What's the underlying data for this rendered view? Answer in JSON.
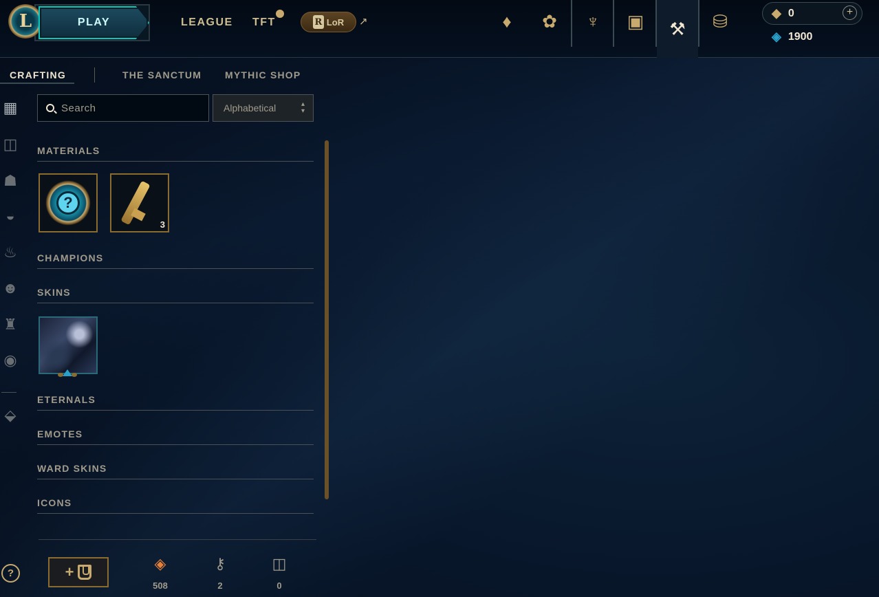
{
  "header": {
    "logo_letter": "L",
    "play_label": "PLAY",
    "nav": [
      {
        "label": "LEAGUE"
      },
      {
        "label": "TFT"
      }
    ],
    "lor_label": "LoR",
    "lor_letter": "R",
    "external_arrow": "↗",
    "icons": [
      {
        "name": "crystal-icon",
        "glyph": "♦"
      },
      {
        "name": "lotus-icon",
        "glyph": "✿"
      },
      {
        "name": "trophy-icon",
        "glyph": "♆"
      },
      {
        "name": "collection-bag-icon",
        "glyph": "▣"
      },
      {
        "name": "loot-hammer-icon",
        "glyph": "⚒"
      },
      {
        "name": "store-coins-icon",
        "glyph": "⛁"
      }
    ],
    "currencies": {
      "riot_points": "0",
      "blue_essence": "1900",
      "add_label": "+"
    }
  },
  "subtabs": [
    {
      "label": "CRAFTING",
      "active": true
    },
    {
      "label": "THE SANCTUM",
      "active": false
    },
    {
      "label": "MYTHIC SHOP",
      "active": false
    }
  ],
  "rail": [
    {
      "name": "rail-all-icon",
      "glyph": "▦"
    },
    {
      "name": "rail-chest-icon",
      "glyph": "◫"
    },
    {
      "name": "rail-champion-icon",
      "glyph": "☗"
    },
    {
      "name": "rail-skin-mask-icon",
      "glyph": "◒"
    },
    {
      "name": "rail-eternal-flame-icon",
      "glyph": "♨"
    },
    {
      "name": "rail-emote-icon",
      "glyph": "☻"
    },
    {
      "name": "rail-ward-icon",
      "glyph": "♜"
    },
    {
      "name": "rail-profile-icon",
      "glyph": "◉"
    },
    {
      "name": "rail-special-icon",
      "glyph": "⬙"
    }
  ],
  "help_label": "?",
  "search": {
    "placeholder": "Search"
  },
  "sort": {
    "selected": "Alphabetical",
    "arrows": "▲▼"
  },
  "sections": [
    {
      "label": "MATERIALS"
    },
    {
      "label": "CHAMPIONS"
    },
    {
      "label": "SKINS"
    },
    {
      "label": "ETERNALS"
    },
    {
      "label": "EMOTES"
    },
    {
      "label": "WARD SKINS"
    },
    {
      "label": "ICONS"
    }
  ],
  "materials": {
    "mystery_orb_symbol": "?",
    "key_fragment_count": "3"
  },
  "bottom": {
    "add_chest_plus": "+",
    "stats": [
      {
        "name": "orange-essence",
        "value": "508",
        "glyph": "◈",
        "color": "#e8813a"
      },
      {
        "name": "key",
        "value": "2",
        "glyph": "⚷",
        "color": "#a09b8c"
      },
      {
        "name": "chest",
        "value": "0",
        "glyph": "◫",
        "color": "#a09b8c"
      }
    ]
  },
  "colors": {
    "gold": "#c8aa6e",
    "teal": "#0ac8b9",
    "blue_essence": "#2aa0c8",
    "background": "#08162a"
  }
}
